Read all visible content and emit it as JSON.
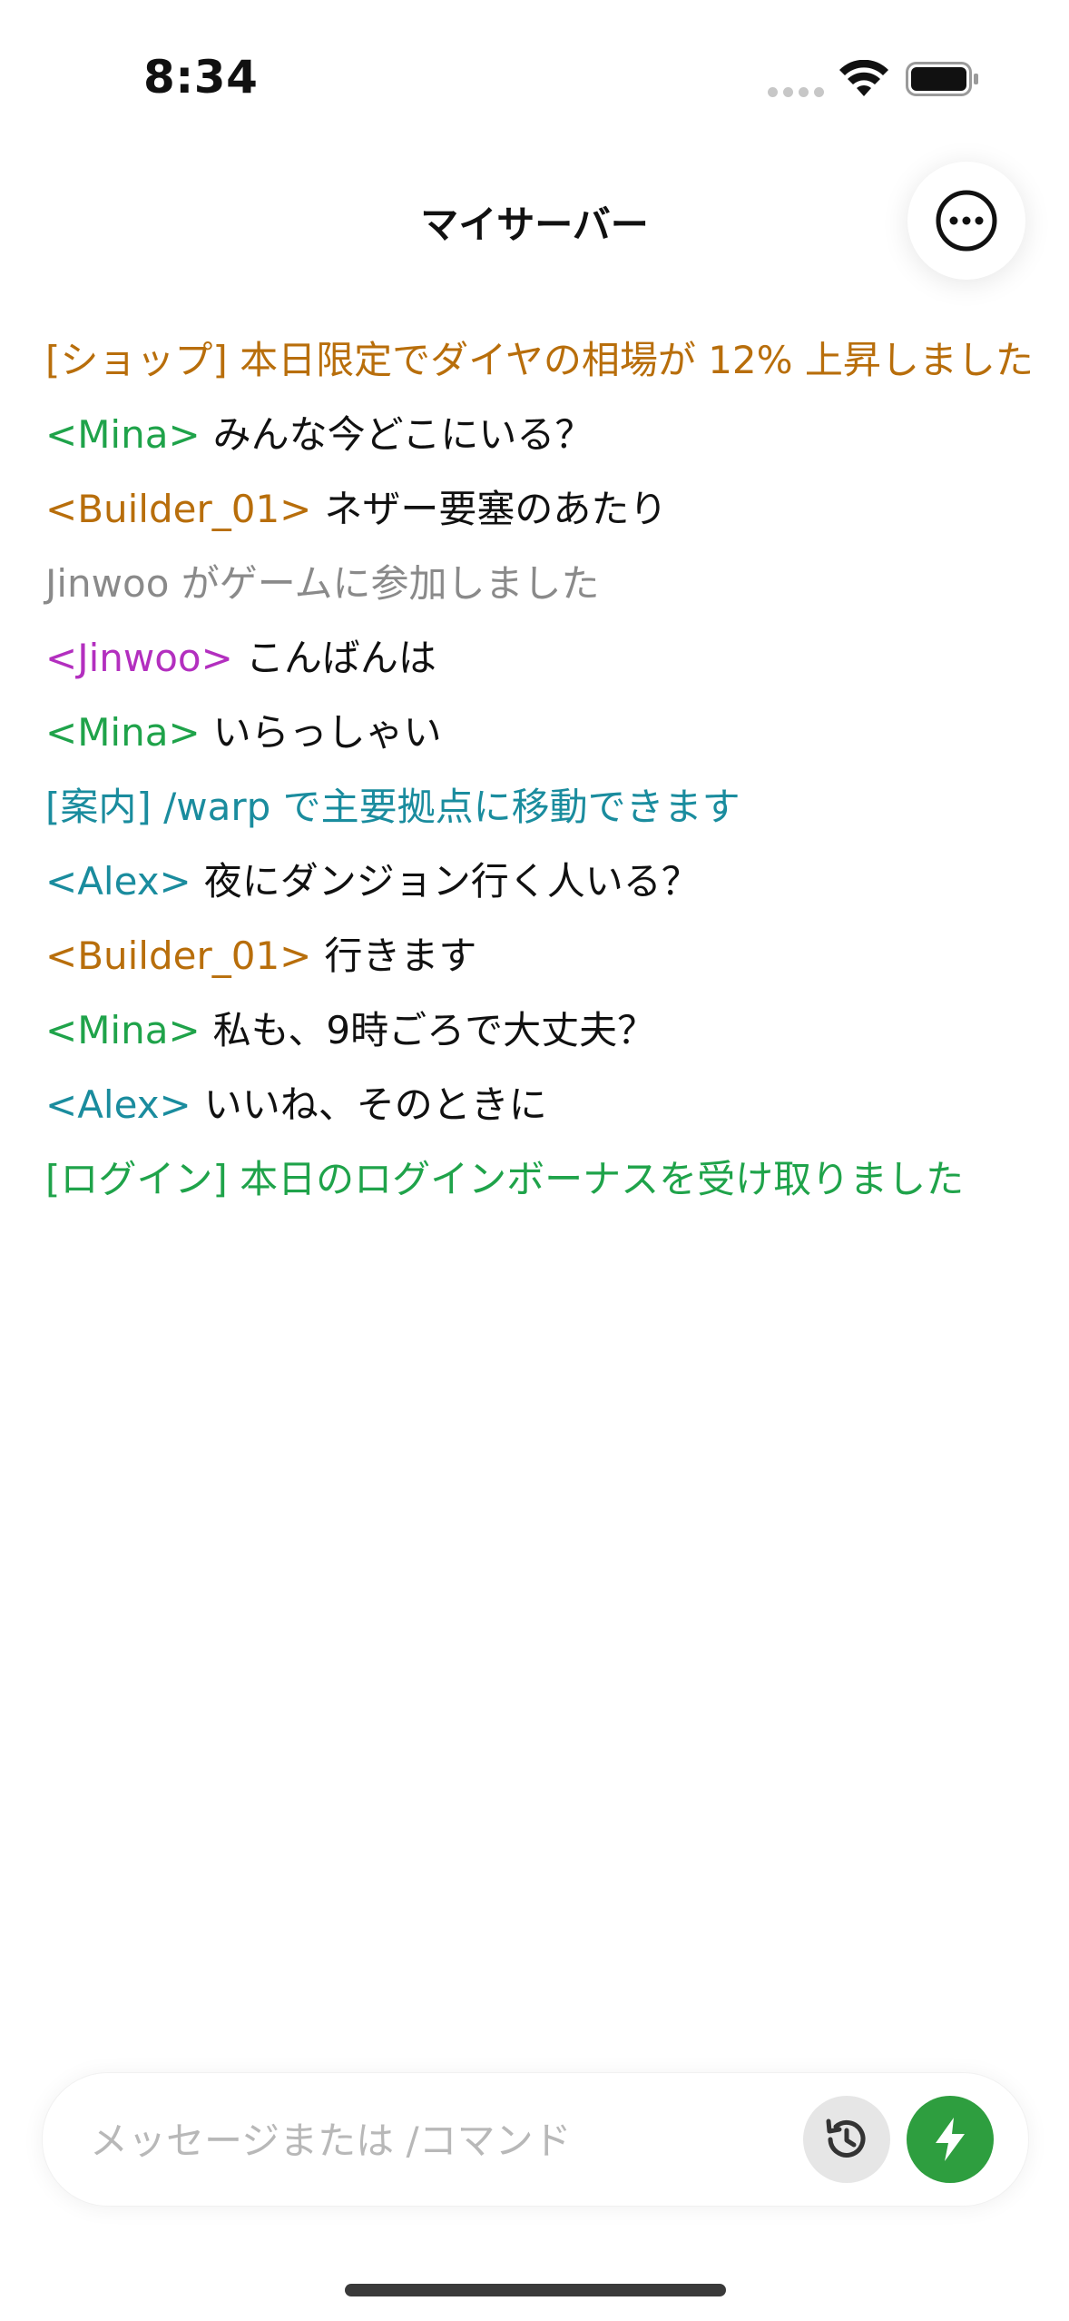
{
  "status_bar": {
    "time": "8:34"
  },
  "header": {
    "title": "マイサーバー",
    "more_icon": "ellipsis-circle-icon"
  },
  "chat": {
    "lines": [
      {
        "sender": "",
        "text": "[ショップ] 本日限定でダイヤの相場が 12% 上昇しました",
        "sender_color": "",
        "text_color": "#b86e0b"
      },
      {
        "sender": "<Mina>",
        "text": "みんな今どこにいる？",
        "sender_color": "#1fa34a",
        "text_color": "#111111"
      },
      {
        "sender": "<Builder_01>",
        "text": "ネザー要塞のあたり",
        "sender_color": "#b86e0b",
        "text_color": "#111111"
      },
      {
        "sender": "",
        "text": "Jinwoo がゲームに参加しました",
        "sender_color": "",
        "text_color": "#8a8a8a"
      },
      {
        "sender": "<Jinwoo>",
        "text": "こんばんは",
        "sender_color": "#b32fbf",
        "text_color": "#111111"
      },
      {
        "sender": "<Mina>",
        "text": "いらっしゃい",
        "sender_color": "#1fa34a",
        "text_color": "#111111"
      },
      {
        "sender": "",
        "text": "[案内] /warp で主要拠点に移動できます",
        "sender_color": "",
        "text_color": "#1a8c9e"
      },
      {
        "sender": "<Alex>",
        "text": "夜にダンジョン行く人いる？",
        "sender_color": "#1a8c9e",
        "text_color": "#111111"
      },
      {
        "sender": "<Builder_01>",
        "text": "行きます",
        "sender_color": "#b86e0b",
        "text_color": "#111111"
      },
      {
        "sender": "<Mina>",
        "text": "私も、9時ごろで大丈夫？",
        "sender_color": "#1fa34a",
        "text_color": "#111111"
      },
      {
        "sender": "<Alex>",
        "text": "いいね、そのときに",
        "sender_color": "#1a8c9e",
        "text_color": "#111111"
      },
      {
        "sender": "",
        "text": "[ログイン] 本日のログインボーナスを受け取りました",
        "sender_color": "",
        "text_color": "#1fa34a"
      }
    ]
  },
  "composer": {
    "value": "",
    "placeholder": "メッセージまたは /コマンド",
    "history_icon": "history-clock-icon",
    "send_icon": "lightning-bolt-icon",
    "send_color": "#2e9e3f"
  }
}
